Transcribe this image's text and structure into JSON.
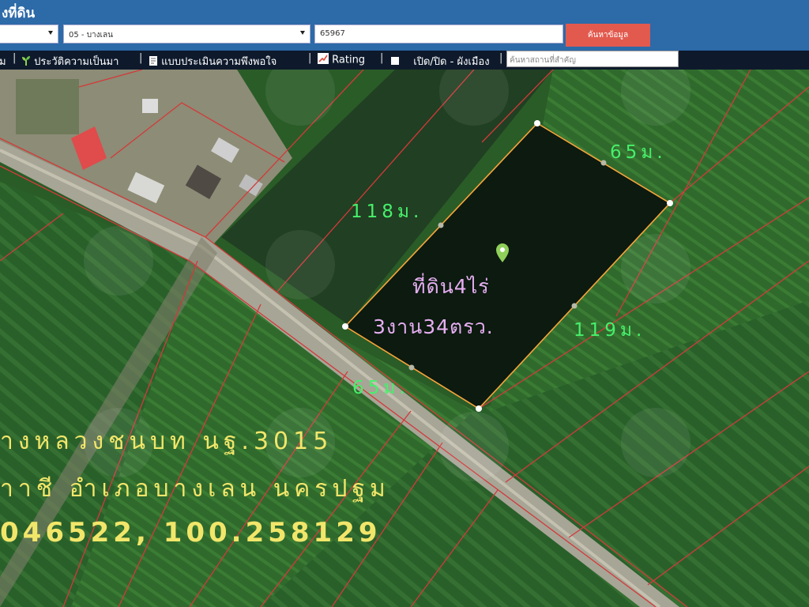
{
  "header": {
    "title": "งที่ดิน",
    "district_select": "05 - บางเลน",
    "parcel_no": "65967",
    "search_button": "ค้นหาข้อมูล"
  },
  "toolbar": {
    "item0": "ม",
    "item1": "ประวัติความเป็นมา",
    "item2": "แบบประเมินความพึงพอใจ",
    "item3": "Rating",
    "item4": "เปิด/ปิด - ผังเมือง",
    "place_placeholder": "ค้นหาสถานที่สำคัญ"
  },
  "map": {
    "side_top": "65ม.",
    "side_left": "118ม.",
    "side_right": "119ม.",
    "side_bottom": "65ม.",
    "area_line1": "ที่ดิน4ไร่",
    "area_line2": "3งาน34ตรว.",
    "road": "างหลวงชนบท นฐ.3015",
    "location": "าาชี อำเภอบางเลน นครปฐม",
    "coords": "046522, 100.258129"
  },
  "colors": {
    "header_bg": "#2d6aa8",
    "toolbar_bg": "#0e1a2c",
    "search_btn": "#e25a4e",
    "parcel_outline": "#f3a53a",
    "dimension_text": "#47f06c",
    "area_text": "#e6aef1",
    "caption_text": "#f2e66a"
  }
}
